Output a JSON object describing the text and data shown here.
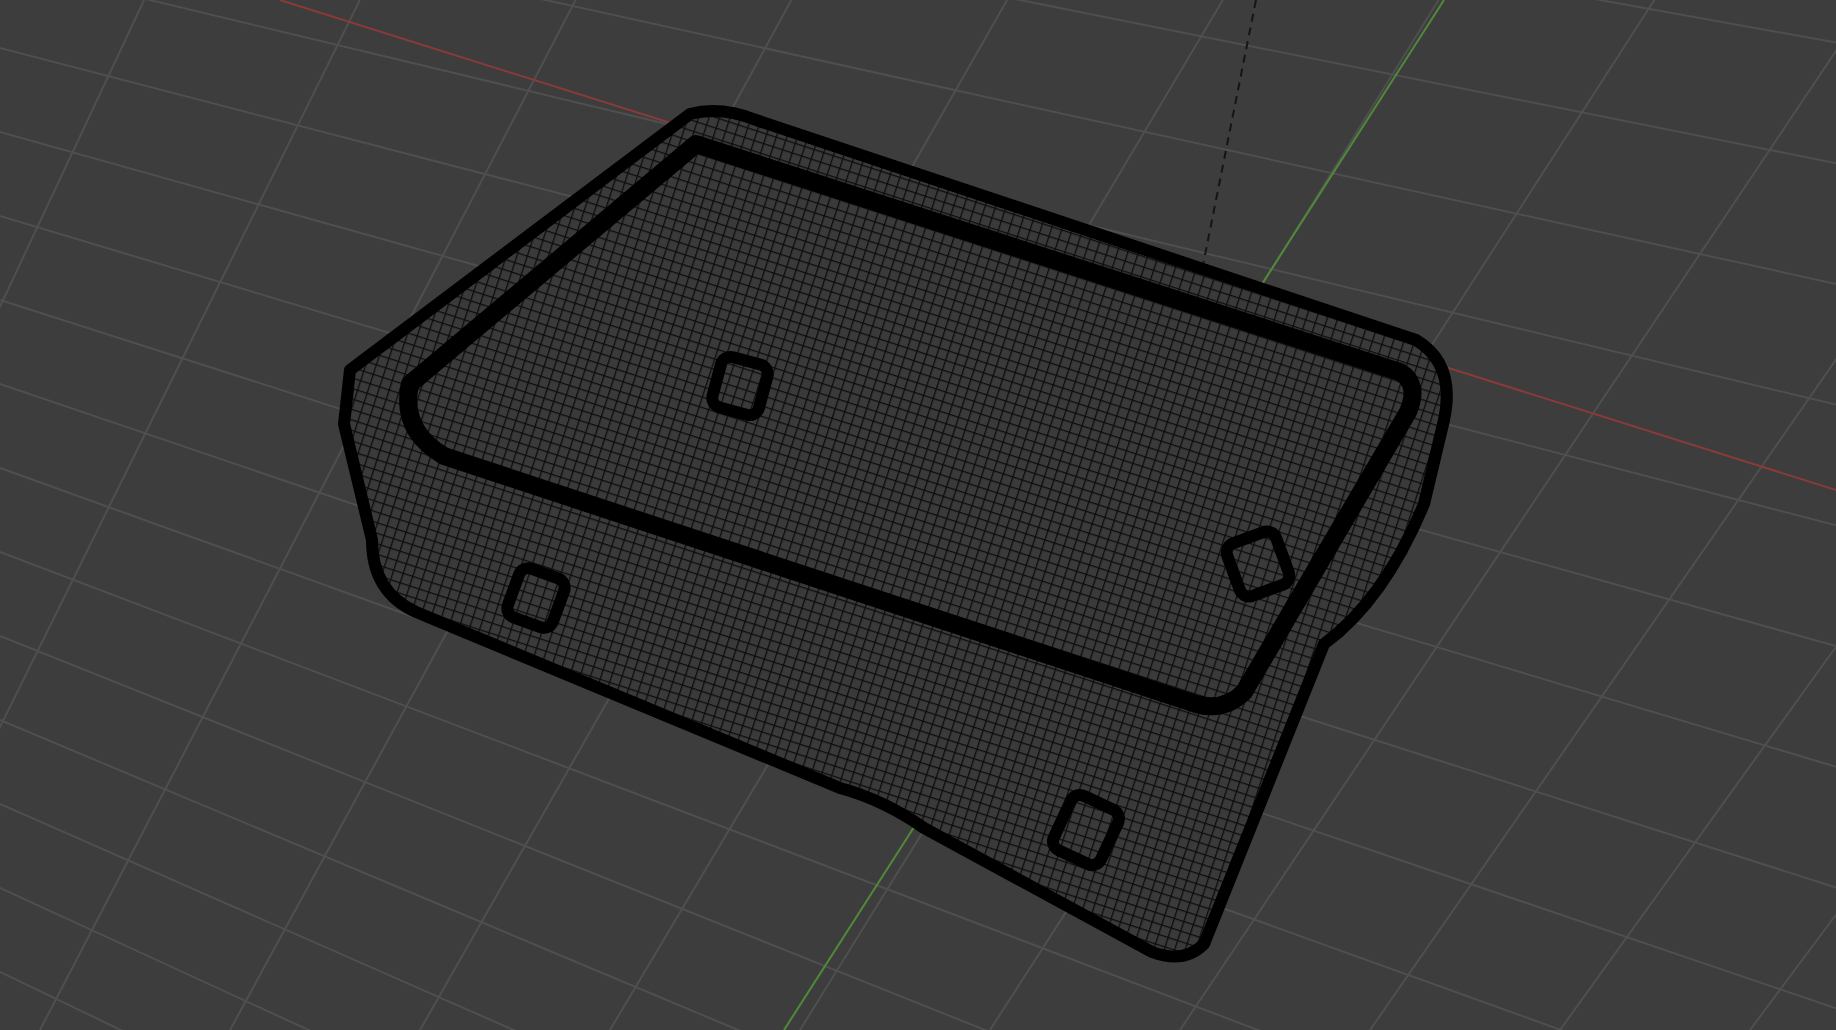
{
  "viewport": {
    "wireframe": true,
    "grid": true
  }
}
